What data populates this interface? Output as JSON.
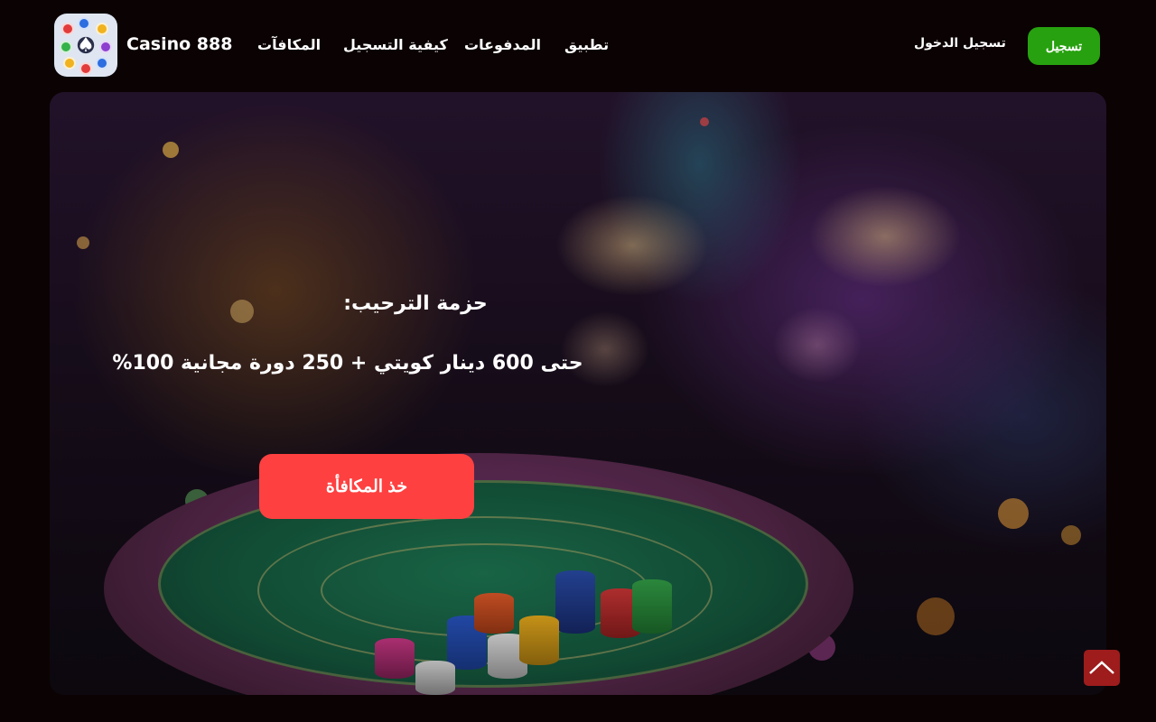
{
  "header": {
    "brand": "Casino 888",
    "nav": [
      {
        "label": "المكافآت"
      },
      {
        "label": "كيفية التسجيل"
      },
      {
        "label": "المدفوعات"
      },
      {
        "label": "تطبيق"
      }
    ],
    "login_label": "تسجيل الدخول",
    "signup_label": "تسجيل"
  },
  "hero": {
    "title": "حزمة الترحيب:",
    "subtitle": "حتى 600 دينار كويتي + 250 دورة مجانية 100%",
    "cta_label": "خذ المكافأة"
  },
  "colors": {
    "background": "#0b0203",
    "signup_button": "#27a10f",
    "cta_button": "#ff4040",
    "scroll_top": "#9e1c1c"
  },
  "icons": {
    "logo": "casino-chips-logo-icon",
    "scroll_top": "chevron-up-icon"
  }
}
